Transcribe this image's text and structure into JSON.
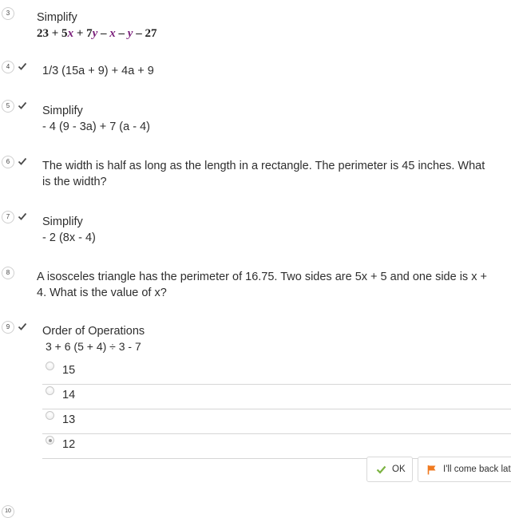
{
  "questions": [
    {
      "number": "3",
      "checked": false,
      "title": "Simplify",
      "expression": {
        "a": "23 + 5",
        "x1": "x",
        "b": " + 7",
        "y1": "y",
        "c": " – ",
        "x2": "x",
        "d": " – ",
        "y2": "y",
        "e": " – 27"
      }
    },
    {
      "number": "4",
      "checked": true,
      "text": "1/3 (15a + 9) + 4a + 9"
    },
    {
      "number": "5",
      "checked": true,
      "title": "Simplify",
      "text": "- 4 (9 - 3a)  + 7 (a - 4)"
    },
    {
      "number": "6",
      "checked": true,
      "line1": "The width is half as long as the length in a rectangle. The perimeter is 45 inches. What",
      "line2": "is the width?"
    },
    {
      "number": "7",
      "checked": true,
      "title": "Simplify",
      "text": "- 2 (8x - 4)"
    },
    {
      "number": "8",
      "checked": false,
      "line1": "A isosceles triangle has the perimeter of 16.75. Two sides are 5x + 5 and one side is x +",
      "line2": "4. What is the value of x?"
    },
    {
      "number": "9",
      "checked": true,
      "title": "Order of Operations",
      "text": "3 + 6 (5 + 4) ÷ 3 - 7",
      "options": [
        {
          "label": "15",
          "selected": false
        },
        {
          "label": "14",
          "selected": false
        },
        {
          "label": "13",
          "selected": false
        },
        {
          "label": "12",
          "selected": true
        }
      ]
    }
  ],
  "actions": {
    "ok_label": "OK",
    "later_label": "I'll come back later"
  },
  "next_number": "10",
  "colors": {
    "check": "#4a4a4a",
    "ok_check": "#7cb342",
    "flag": "#f07a20",
    "variable": "#7a1e7a"
  }
}
